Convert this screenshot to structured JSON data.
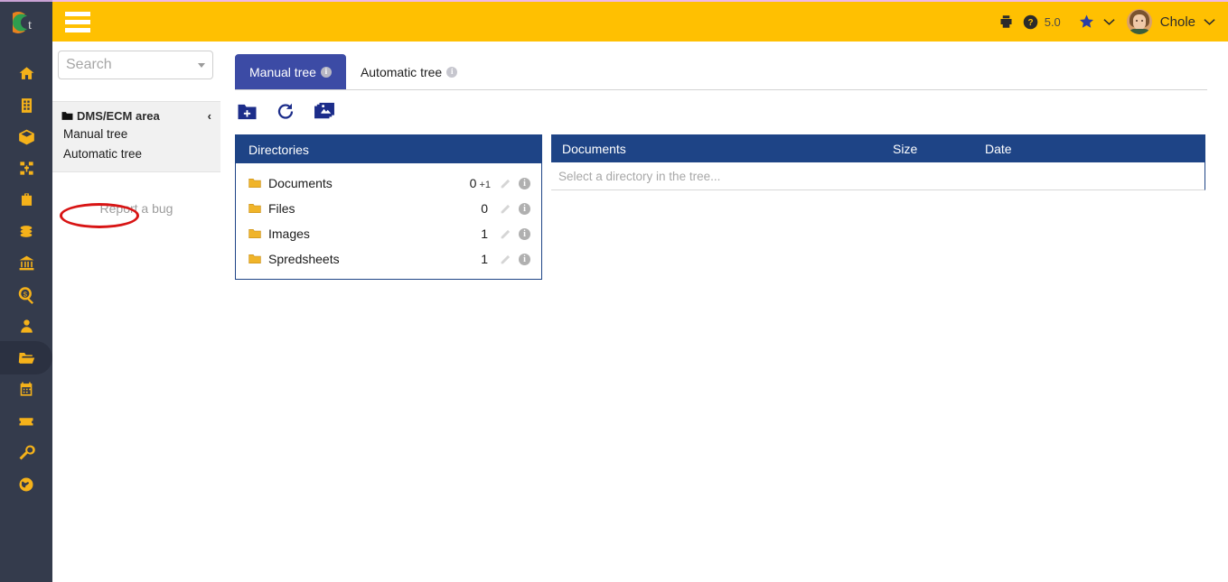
{
  "brand": {
    "logo_alt": "company-logo",
    "header_color": "#ffc001",
    "rail_color": "#343b4c",
    "panel_header_color": "#1e4486",
    "active_tab_color": "#3c4ba5",
    "annotation_color": "#d81414"
  },
  "topbar": {
    "menu_label": "menu",
    "version": "5.0",
    "user_name": "Chole"
  },
  "rail": {
    "items": [
      {
        "name": "home",
        "label": "Home",
        "active": false
      },
      {
        "name": "building",
        "label": "Company",
        "active": false
      },
      {
        "name": "box",
        "label": "Products",
        "active": false
      },
      {
        "name": "sitemap",
        "label": "Structure",
        "active": false
      },
      {
        "name": "briefcase",
        "label": "Business",
        "active": false
      },
      {
        "name": "coins",
        "label": "Finance",
        "active": false
      },
      {
        "name": "bank",
        "label": "Banking",
        "active": false
      },
      {
        "name": "search-dollar",
        "label": "Analytics",
        "active": false
      },
      {
        "name": "user",
        "label": "Contacts",
        "active": false
      },
      {
        "name": "folder-open",
        "label": "Documents",
        "active": true
      },
      {
        "name": "calendar",
        "label": "Calendar",
        "active": false
      },
      {
        "name": "ticket",
        "label": "Tickets",
        "active": false
      },
      {
        "name": "wrench",
        "label": "Tools",
        "active": false
      },
      {
        "name": "globe",
        "label": "Web",
        "active": false
      }
    ]
  },
  "left_panel": {
    "search_placeholder": "Search",
    "tree_header": "DMS/ECM area",
    "collapse_chevron": "‹",
    "items": [
      {
        "label": "Manual tree",
        "selected": true
      },
      {
        "label": "Automatic tree",
        "selected": false
      }
    ],
    "report_bug": "Report a bug"
  },
  "main": {
    "tabs": [
      {
        "label": "Manual tree",
        "active": true,
        "info": "i"
      },
      {
        "label": "Automatic tree",
        "active": false,
        "info": "i"
      }
    ],
    "toolbar": [
      {
        "name": "add-folder-icon",
        "title": "Add folder"
      },
      {
        "name": "refresh-icon",
        "title": "Refresh"
      },
      {
        "name": "images-icon",
        "title": "Images"
      }
    ],
    "directories_panel": {
      "title": "Directories",
      "rows": [
        {
          "name": "Documents",
          "count": "0",
          "extra": "+1"
        },
        {
          "name": "Files",
          "count": "0",
          "extra": ""
        },
        {
          "name": "Images",
          "count": "1",
          "extra": ""
        },
        {
          "name": "Spredsheets",
          "count": "1",
          "extra": ""
        }
      ],
      "edit_icon": "pencil-icon",
      "info_icon": "i"
    },
    "documents_panel": {
      "columns": [
        "Documents",
        "Size",
        "Date"
      ],
      "empty_message": "Select a directory in the tree..."
    }
  }
}
